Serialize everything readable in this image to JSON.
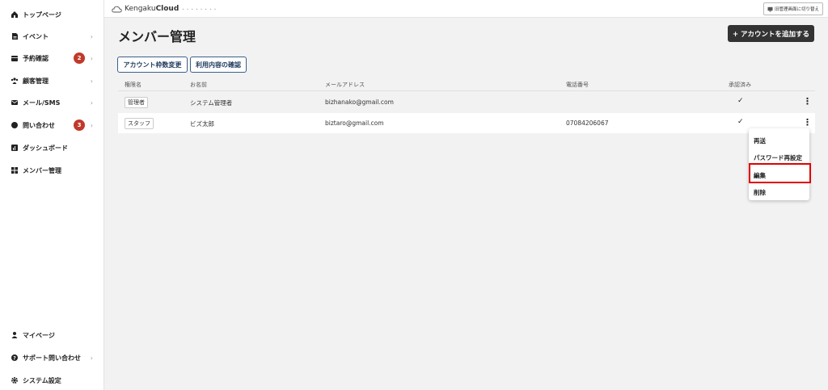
{
  "sidebar": {
    "items": [
      {
        "label": "トップページ",
        "icon": "home-icon"
      },
      {
        "label": "イベント",
        "icon": "document-icon",
        "chevron": "›"
      },
      {
        "label": "予約確認",
        "icon": "calendar-icon",
        "badge": "2",
        "chevron": "›"
      },
      {
        "label": "顧客管理",
        "icon": "users-icon",
        "chevron": "›"
      },
      {
        "label": "メール/SMS",
        "icon": "mail-icon",
        "chevron": "›"
      },
      {
        "label": "問い合わせ",
        "icon": "chat-icon",
        "badge": "3",
        "chevron": "›"
      },
      {
        "label": "ダッシュボード",
        "icon": "chart-icon"
      },
      {
        "label": "メンバー管理",
        "icon": "grid-icon"
      }
    ],
    "bottom_items": [
      {
        "label": "マイページ",
        "icon": "person-icon"
      },
      {
        "label": "サポート問い合わせ",
        "icon": "question-icon",
        "chevron": "›"
      },
      {
        "label": "システム設定",
        "icon": "gear-icon"
      }
    ]
  },
  "topbar": {
    "logo_prefix": "Kengaku",
    "logo_bold": "Cloud",
    "old_admin_label": "旧管理画面に切り替え"
  },
  "main": {
    "title": "メンバー管理",
    "add_button": "+ アカウントを追加する",
    "account_limit_button": "アカウント枠数変更",
    "usage_button": "利用内容の確認",
    "table": {
      "headers": [
        "権限名",
        "お名前",
        "メールアドレス",
        "電話番号",
        "承認済み"
      ],
      "rows": [
        {
          "role": "管理者",
          "name": "システム管理者",
          "email": "bizhanako@gmail.com",
          "phone": "",
          "approved": "✓"
        },
        {
          "role": "スタッフ",
          "name": "ビズ太郎",
          "email": "biztaro@gmail.com",
          "phone": "07084206067",
          "approved": "✓"
        }
      ]
    },
    "row_menu": [
      "再送",
      "パスワード再設定",
      "編集",
      "削除"
    ]
  },
  "colors": {
    "badge": "#c0392b",
    "highlight": "#e00000",
    "primary_dark": "#333333",
    "secondary_border": "#3a5f8a"
  }
}
